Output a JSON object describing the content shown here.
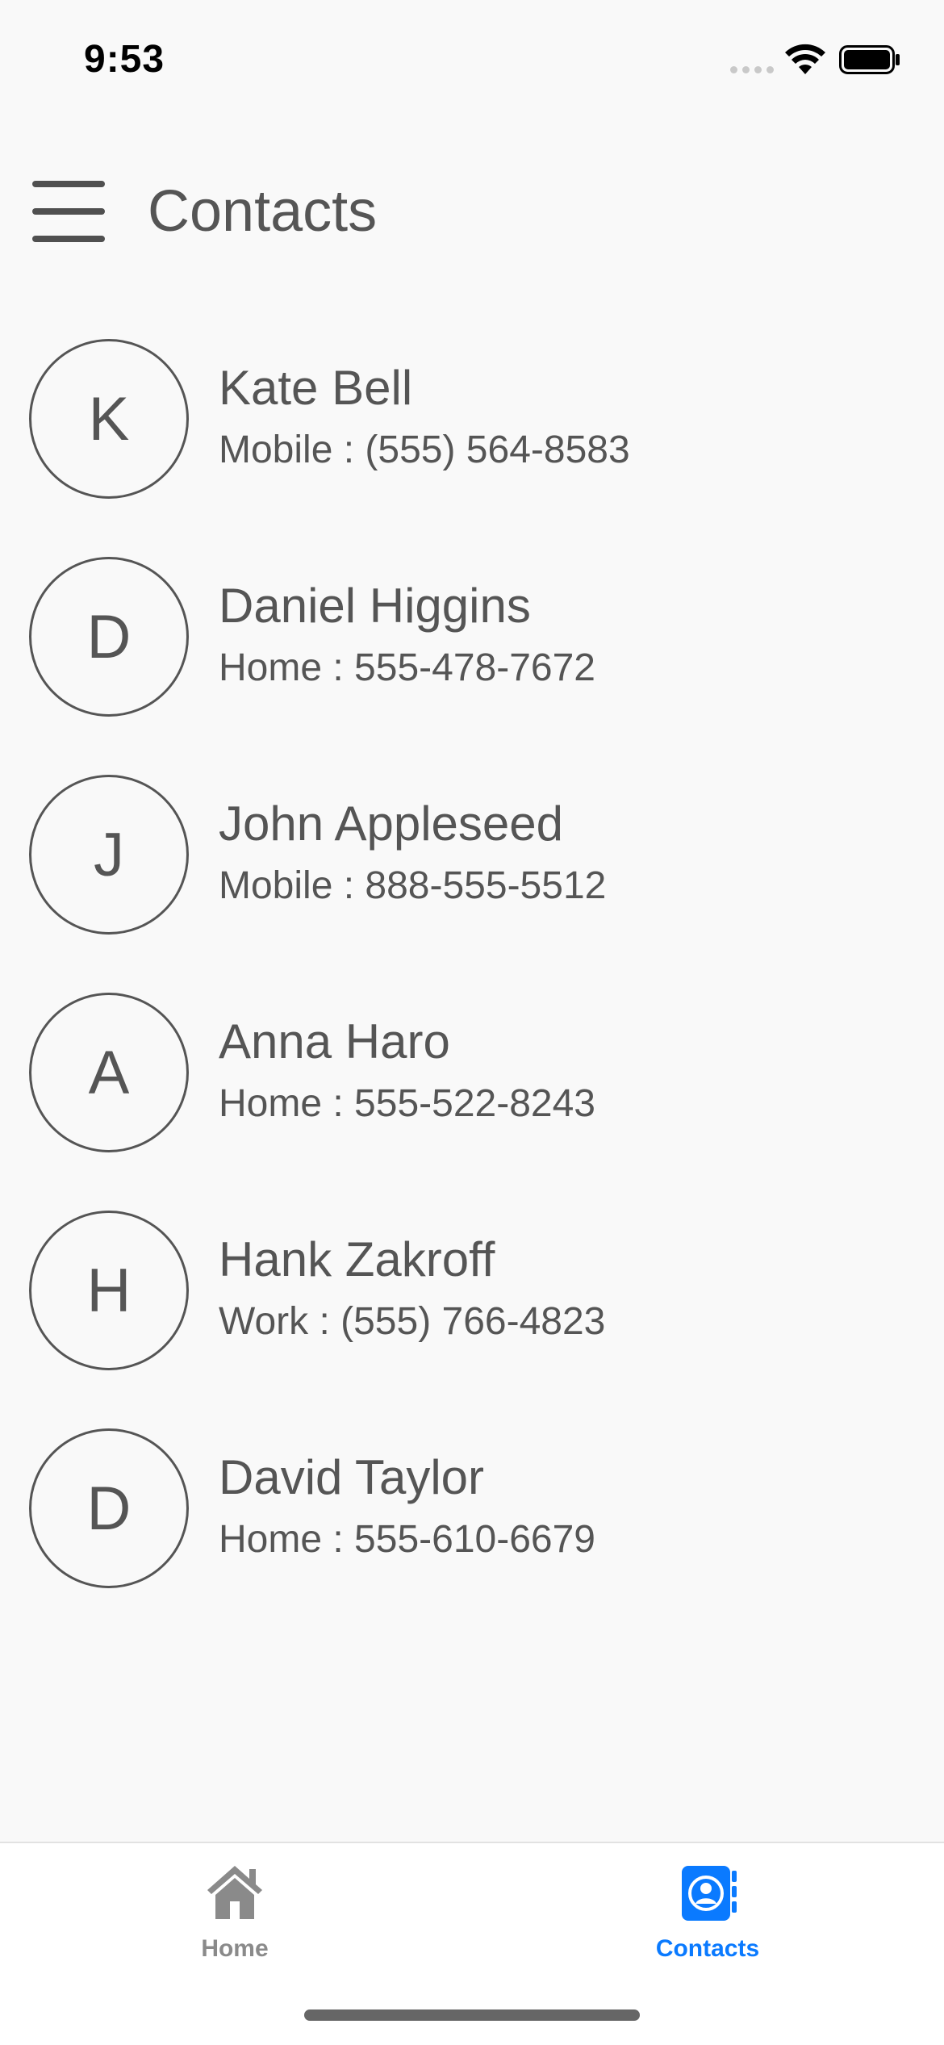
{
  "status_bar": {
    "time": "9:53"
  },
  "header": {
    "title": "Contacts",
    "menu_icon": "hamburger-menu-icon"
  },
  "contacts": [
    {
      "initial": "K",
      "name": "Kate Bell",
      "phone": "Mobile : (555) 564-8583"
    },
    {
      "initial": "D",
      "name": "Daniel Higgins",
      "phone": "Home : 555-478-7672"
    },
    {
      "initial": "J",
      "name": "John Appleseed",
      "phone": "Mobile : 888-555-5512"
    },
    {
      "initial": "A",
      "name": "Anna Haro",
      "phone": "Home : 555-522-8243"
    },
    {
      "initial": "H",
      "name": "Hank Zakroff",
      "phone": "Work : (555) 766-4823"
    },
    {
      "initial": "D",
      "name": "David Taylor",
      "phone": "Home : 555-610-6679"
    }
  ],
  "tab_bar": {
    "tabs": [
      {
        "label": "Home",
        "icon": "house-icon",
        "active": false
      },
      {
        "label": "Contacts",
        "icon": "contacts-book-icon",
        "active": true
      }
    ]
  },
  "colors": {
    "background": "#f9f9f9",
    "text": "#555555",
    "accent": "#0a7aff",
    "inactive_tab": "#8a8a8a"
  }
}
